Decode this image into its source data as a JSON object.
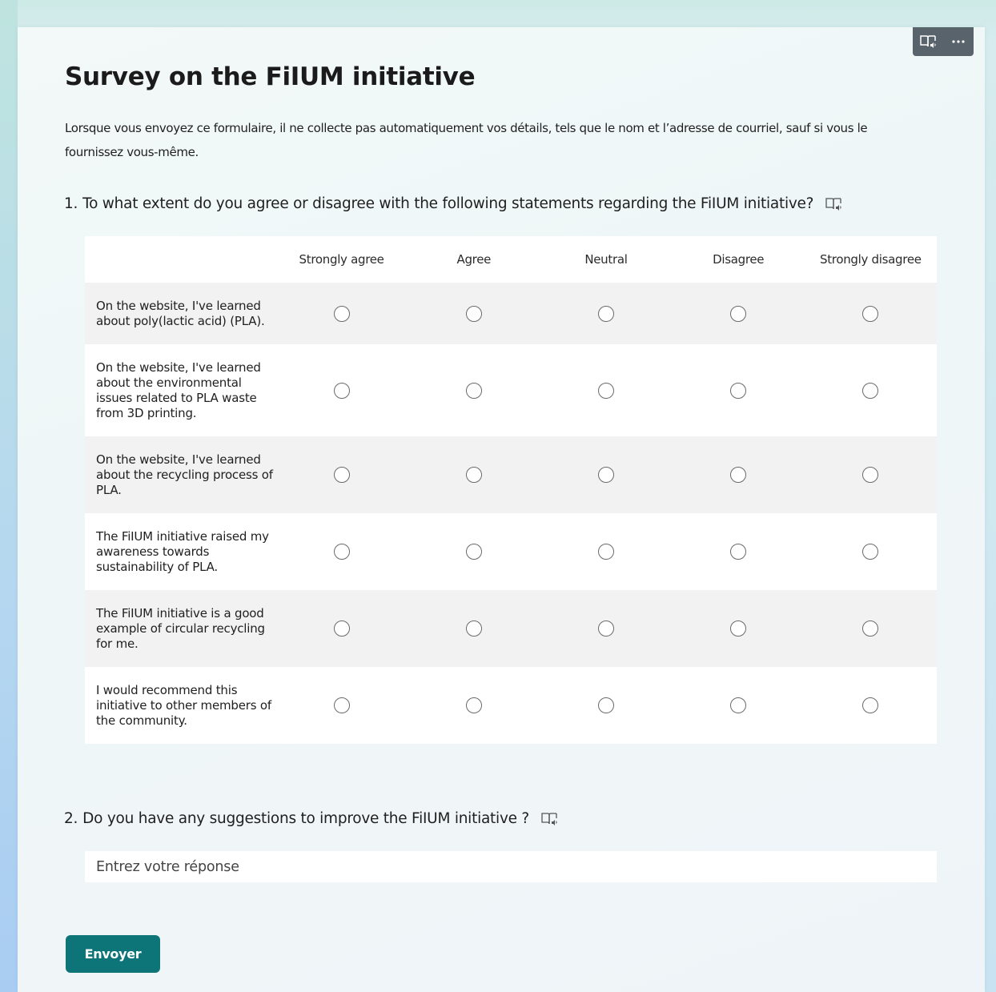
{
  "form": {
    "title": "Survey on the FiIUM initiative",
    "description": "Lorsque vous envoyez ce formulaire, il ne collecte pas automatiquement vos détails, tels que le nom et l’adresse de courriel, sauf si vous le fournissez vous-même."
  },
  "toolbar": {
    "icons": [
      "immersive-reader-icon",
      "more-options-icon"
    ],
    "more_label": "···"
  },
  "questions": [
    {
      "number": "1.",
      "text": "To what extent do you agree or disagree with the following statements regarding the FiIUM initiative?",
      "type": "likert",
      "columns": [
        "Strongly agree",
        "Agree",
        "Neutral",
        "Disagree",
        "Strongly disagree"
      ],
      "rows": [
        "On the website, I've learned about poly(lactic acid) (PLA).",
        "On the website, I've learned about the environmental issues related to PLA waste from 3D printing.",
        "On the website, I've learned about the recycling process of PLA.",
        "The FiIUM initiative raised my awareness towards sustainability of PLA.",
        "The FiIUM initiative is a good example of circular recycling for me.",
        "I would recommend this initiative to other members of the community."
      ]
    },
    {
      "number": "2.",
      "text": "Do you have any suggestions to improve the FiIUM initiative ?",
      "type": "text",
      "placeholder": "Entrez votre réponse",
      "value": ""
    }
  ],
  "submit": {
    "label": "Envoyer"
  },
  "colors": {
    "accent": "#0d7477",
    "toolbar": "#59636b"
  }
}
